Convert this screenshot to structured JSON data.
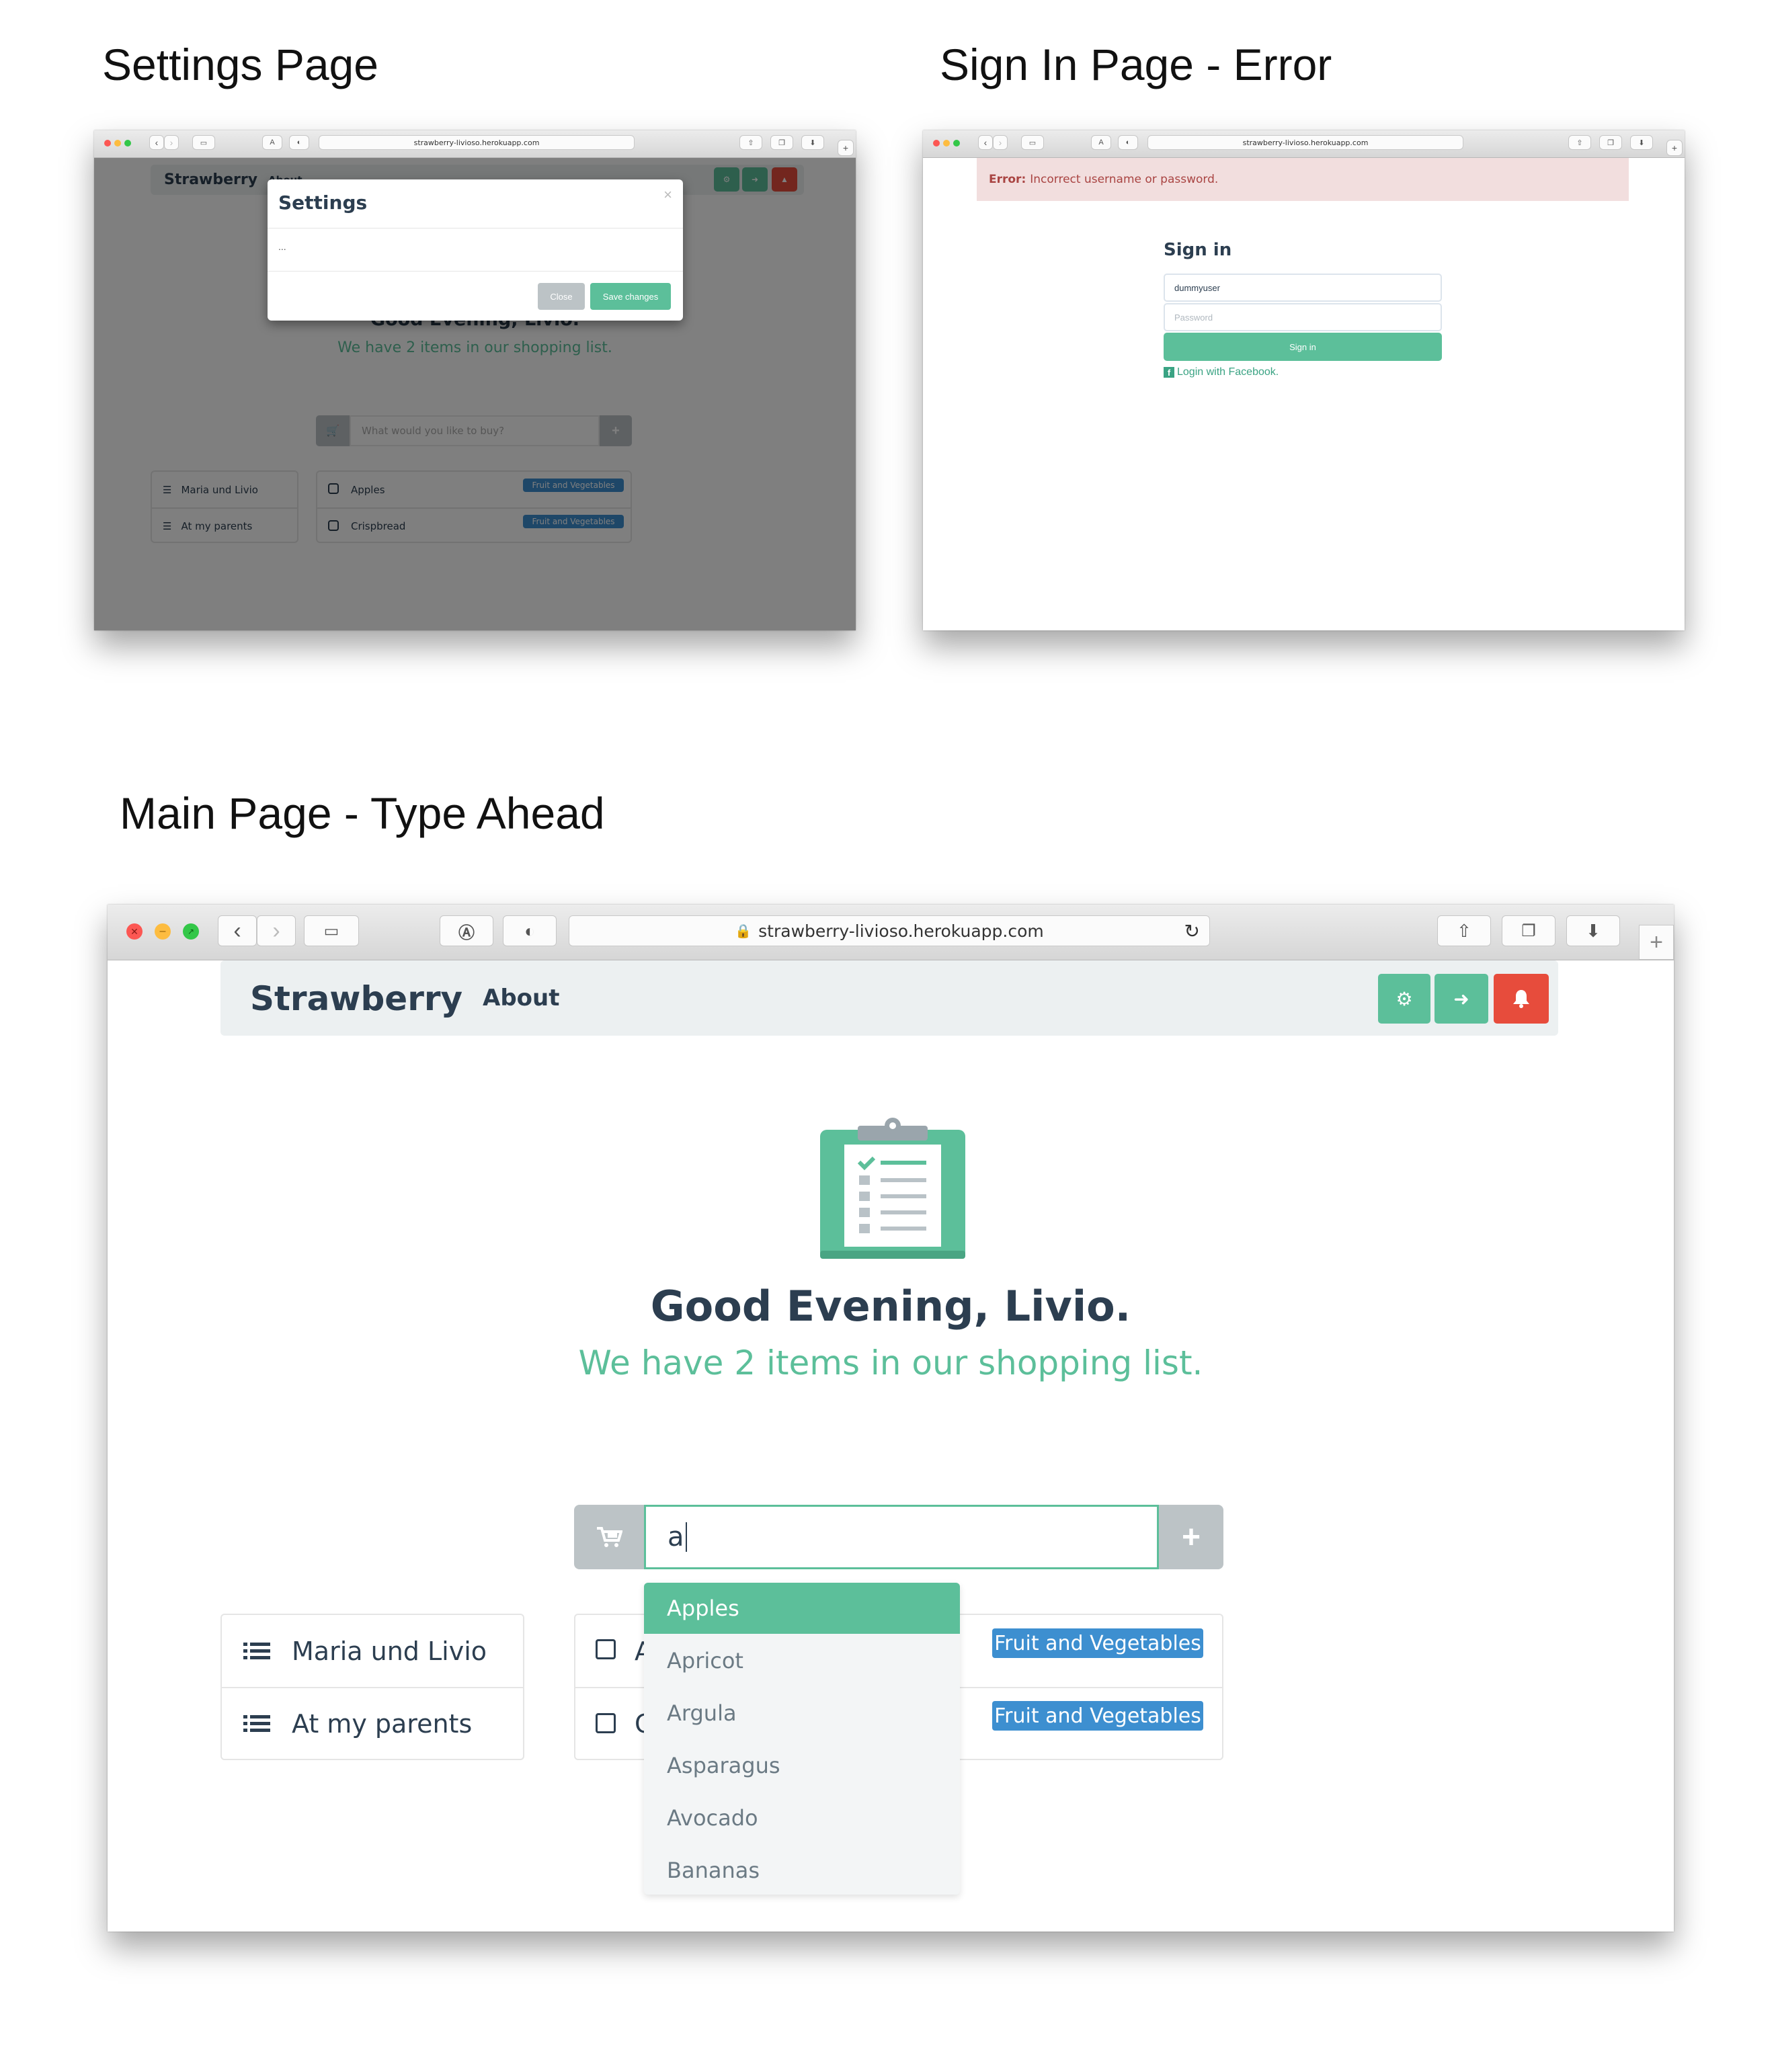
{
  "titles": {
    "settings": "Settings Page",
    "signin": "Sign In Page - Error",
    "main": "Main Page - Type Ahead"
  },
  "browser": {
    "url": "strawberry-livioso.herokuapp.com"
  },
  "app": {
    "brand": "Strawberry",
    "about": "About",
    "greeting": "Good Evening, Livio.",
    "subtitle": "We have 2 items in our shopping list.",
    "search_placeholder": "What would you like to buy?",
    "search_value": "a",
    "lists": [
      {
        "label": "Maria und Livio"
      },
      {
        "label": "At my parents"
      }
    ],
    "items": [
      {
        "label": "Apples",
        "badge": "Fruit and Vegetables"
      },
      {
        "label": "Crispbread",
        "badge": "Fruit and Vegetables"
      }
    ],
    "suggestions": [
      "Apples",
      "Apricot",
      "Argula",
      "Asparagus",
      "Avocado",
      "Bananas"
    ]
  },
  "settings_modal": {
    "title": "Settings",
    "close_x": "×",
    "body": "...",
    "close_button": "Close",
    "save_button": "Save changes"
  },
  "signin": {
    "error_label": "Error:",
    "error_text": "Incorrect username or password.",
    "heading": "Sign in",
    "username_value": "dummyuser",
    "password_placeholder": "Password",
    "button": "Sign in",
    "facebook": "Login with Facebook."
  },
  "colors": {
    "primary_green": "#5cbf9a",
    "danger_red": "#e74c3c",
    "badge_blue": "#3d8fd0",
    "dark_text": "#2c3e50"
  }
}
